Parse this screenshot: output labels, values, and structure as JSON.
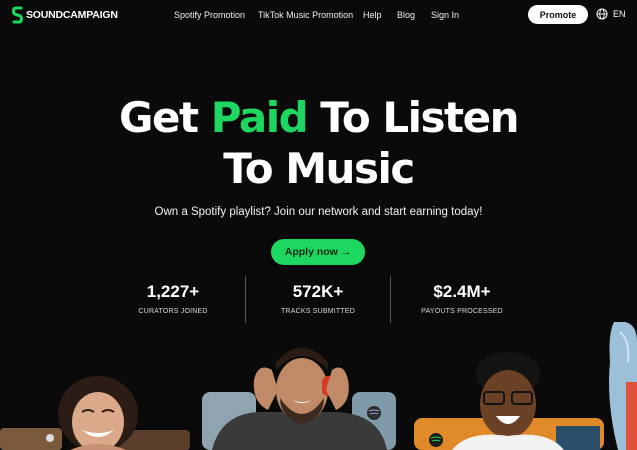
{
  "nav": {
    "logo_text": "SOUNDCAMPAIGN",
    "links": [
      {
        "label": "Spotify Promotion"
      },
      {
        "label": "TikTok Music Promotion"
      },
      {
        "label": "Help"
      },
      {
        "label": "Blog"
      },
      {
        "label": "Sign In"
      }
    ],
    "promote_label": "Promote",
    "language": "EN"
  },
  "hero": {
    "title_pre": "Get ",
    "title_accent": "Paid",
    "title_post": " To Listen",
    "title_line2": "To Music",
    "subtitle": "Own a Spotify playlist? Join our network and start earning today!",
    "cta_label": "Apply now →"
  },
  "stats": [
    {
      "value": "1,227+",
      "label": "CURATORS JOINED"
    },
    {
      "value": "572K+",
      "label": "TRACKS SUBMITTED"
    },
    {
      "value": "$2.4M+",
      "label": "PAYOUTS PROCESSED"
    }
  ],
  "colors": {
    "accent": "#1ed760",
    "background": "#0a0a0a",
    "text": "#ffffff"
  }
}
